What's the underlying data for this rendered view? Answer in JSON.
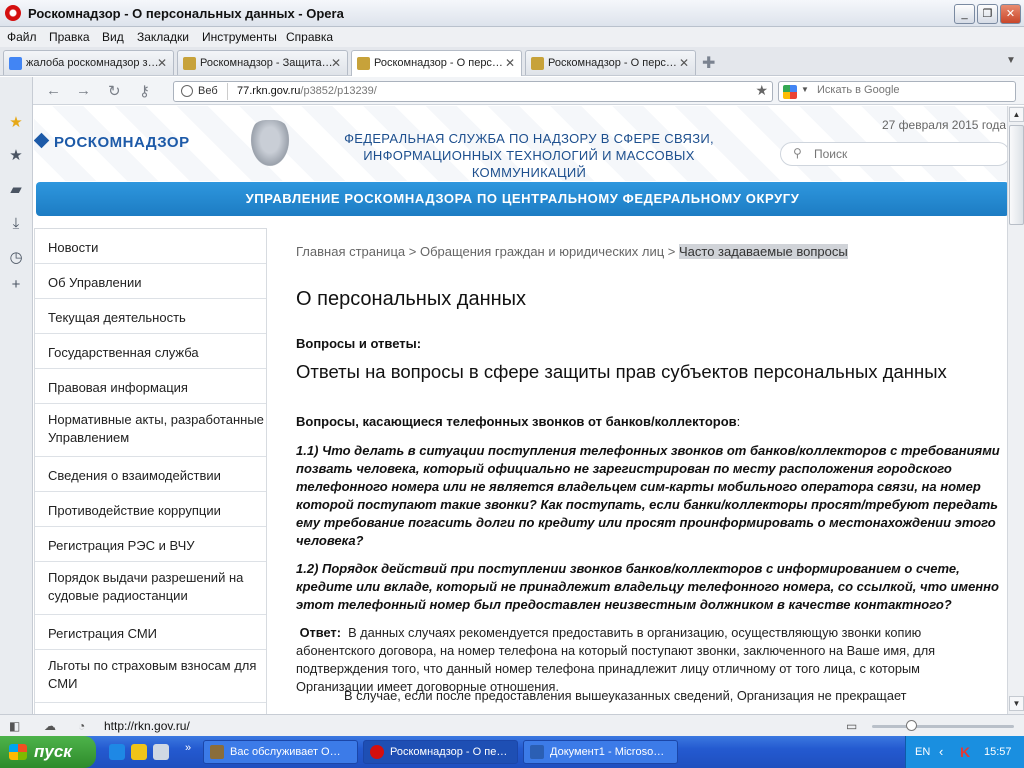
{
  "window": {
    "title": "Роскомнадзор - О персональных данных - Opera"
  },
  "menu": [
    "Файл",
    "Правка",
    "Вид",
    "Закладки",
    "Инструменты",
    "Справка"
  ],
  "tabs": [
    {
      "label": "жалоба роскомнадзор з…",
      "icon_color": "#4285f4"
    },
    {
      "label": "Роскомнадзор - Защита…",
      "icon_color": "#c7a23a"
    },
    {
      "label": "Роскомнадзор - О перс…",
      "icon_color": "#c7a23a"
    },
    {
      "label": "Роскомнадзор - О перс…",
      "icon_color": "#c7a23a"
    }
  ],
  "address": {
    "web_badge": "Веб",
    "url_host": "77.rkn.gov.ru",
    "url_path": "/p3852/p13239/",
    "search_placeholder": "Искать в Google"
  },
  "site": {
    "logo": "РОСКОМНАДЗОР",
    "agency_line1": "ФЕДЕРАЛЬНАЯ СЛУЖБА ПО НАДЗОРУ В СФЕРЕ СВЯЗИ,",
    "agency_line2": "ИНФОРМАЦИОННЫХ ТЕХНОЛОГИЙ И МАССОВЫХ КОММУНИКАЦИЙ",
    "date": "27 февраля 2015 года",
    "search_placeholder": "Поиск",
    "banner": "УПРАВЛЕНИЕ РОСКОМНАДЗОРА ПО ЦЕНТРАЛЬНОМУ ФЕДЕРАЛЬНОМУ ОКРУГУ",
    "brand_color": "#1d5aa8"
  },
  "nav": [
    "Новости",
    "Об Управлении",
    "Текущая деятельность",
    "Государственная служба",
    "Правовая информация",
    "Нормативные акты, разработанные Управлением",
    "Сведения о взаимодействии",
    "Противодействие коррупции",
    "Регистрация РЭС и ВЧУ",
    "Порядок выдачи разрешений на судовые радиостанции",
    "Регистрация СМИ",
    "Льготы по страховым взносам для СМИ"
  ],
  "content": {
    "breadcrumb_home": "Главная страница",
    "breadcrumb_sep": " > ",
    "breadcrumb_section": "Обращения граждан и юридических лиц",
    "breadcrumb_current": "Часто задаваемые вопросы",
    "page_title": "О персональных данных",
    "qa_label": "Вопросы и ответы:",
    "qa_title": "Ответы на вопросы в сфере защиты прав субъектов персональных данных",
    "section_title": "Вопросы, касающиеся телефонных звонков от банков/коллекторов",
    "section_colon": ":",
    "q1": "1.1) Что делать в ситуации поступления телефонных звонков от  банков/коллекторов с требованиями позвать человека, который официально не зарегистрирован по месту расположения городского телефонного номера или не является владельцем сим-карты мобильного оператора связи, на номер которой поступают такие звонки? Как поступать, если банки/коллекторы просят/требуют  передать ему требование погасить долги по кредиту или просят проинформировать о местонахождении этого человека?",
    "q2": "1.2) Порядок действий при поступлении звонков банков/коллекторов с информированием о счете, кредите или вкладе, который не принадлежит владельцу телефонного номера, со ссылкой, что именно этот телефонный номер был предоставлен неизвестным должником в качестве контактного?",
    "answer_label": "Ответ:",
    "answer": "В данных случаях рекомендуется предоставить в организацию, осуществляющую звонки копию абонентского договора, на номер телефона на который поступают звонки, заключенного на Ваше имя, для подтверждения того, что данный номер телефона принадлежит лицу отличному от того лица, с которым Организации имеет договорные отношения.",
    "answer2": "В случае, если после предоставления вышеуказанных сведений, Организация не прекращает"
  },
  "status": {
    "url": "http://rkn.gov.ru/"
  },
  "taskbar": {
    "start": "пуск",
    "buttons": [
      {
        "label": "Вас обслуживает О…",
        "icon_color": "#8a6d3b"
      },
      {
        "label": "Роскомнадзор - О пе…",
        "icon_color": "#d40f0f"
      },
      {
        "label": "Документ1 - Microso…",
        "icon_color": "#2b5fb4"
      }
    ],
    "lang": "EN",
    "clock": "15:57"
  }
}
